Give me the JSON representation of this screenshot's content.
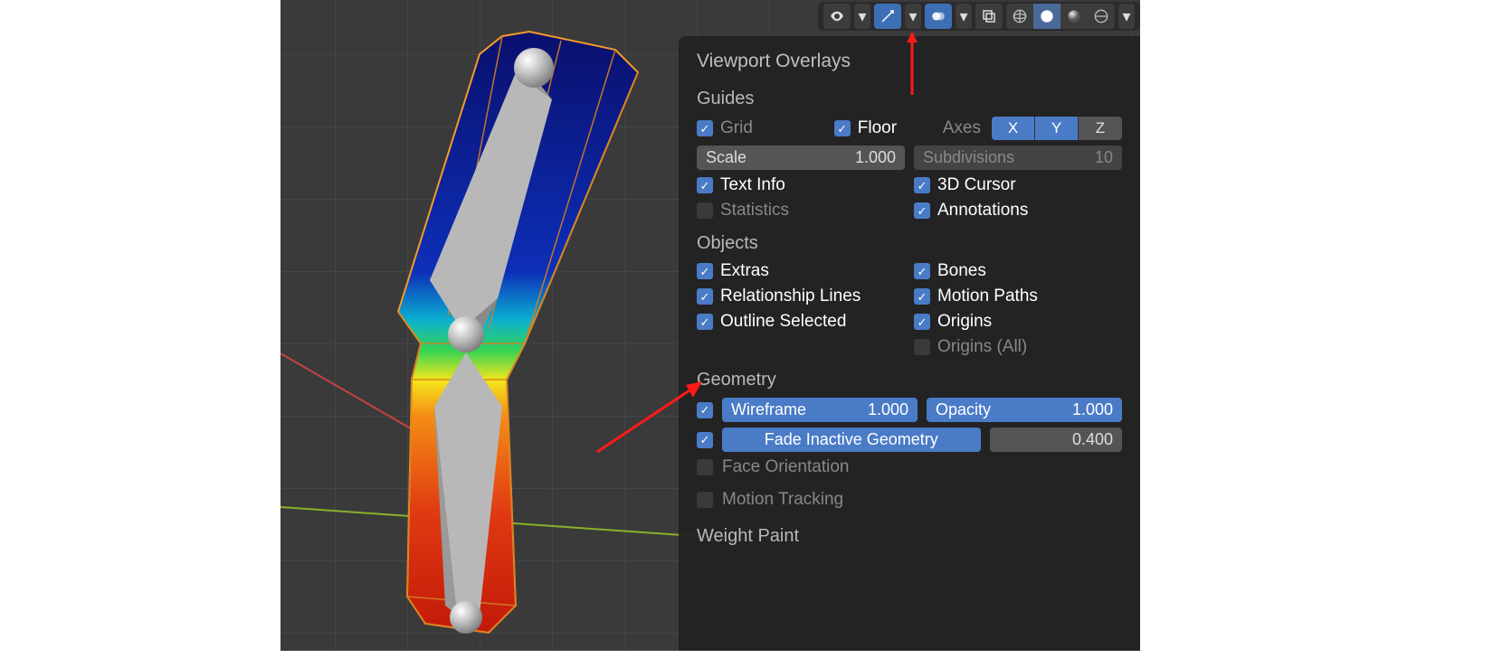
{
  "header": {
    "visibility_active": false,
    "gizmo_active": true,
    "overlays_active": true,
    "shading_active_index": 2
  },
  "panel": {
    "title": "Viewport Overlays",
    "guides": {
      "heading": "Guides",
      "grid": {
        "label": "Grid",
        "checked": true,
        "dim": true
      },
      "floor": {
        "label": "Floor",
        "checked": true
      },
      "axes_label": "Axes",
      "axes": {
        "x": true,
        "y": true,
        "z": false
      },
      "scale": {
        "label": "Scale",
        "value": "1.000"
      },
      "subdivisions": {
        "label": "Subdivisions",
        "value": "10"
      },
      "text_info": {
        "label": "Text Info",
        "checked": true
      },
      "cursor3d": {
        "label": "3D Cursor",
        "checked": true
      },
      "statistics": {
        "label": "Statistics",
        "checked": false
      },
      "annotations": {
        "label": "Annotations",
        "checked": true
      }
    },
    "objects": {
      "heading": "Objects",
      "extras": {
        "label": "Extras",
        "checked": true
      },
      "bones": {
        "label": "Bones",
        "checked": true
      },
      "relationship_lines": {
        "label": "Relationship Lines",
        "checked": true
      },
      "motion_paths": {
        "label": "Motion Paths",
        "checked": true
      },
      "outline_selected": {
        "label": "Outline Selected",
        "checked": true
      },
      "origins": {
        "label": "Origins",
        "checked": true
      },
      "origins_all": {
        "label": "Origins (All)",
        "checked": false
      }
    },
    "geometry": {
      "heading": "Geometry",
      "wireframe": {
        "checked": true,
        "label": "Wireframe",
        "value": "1.000"
      },
      "opacity": {
        "label": "Opacity",
        "value": "1.000"
      },
      "fade_inactive": {
        "checked": true,
        "label": "Fade Inactive Geometry",
        "value": "0.400"
      },
      "face_orientation": {
        "label": "Face Orientation",
        "checked": false
      },
      "motion_tracking": {
        "label": "Motion Tracking",
        "checked": false
      }
    },
    "weight_paint": {
      "heading": "Weight Paint"
    }
  }
}
